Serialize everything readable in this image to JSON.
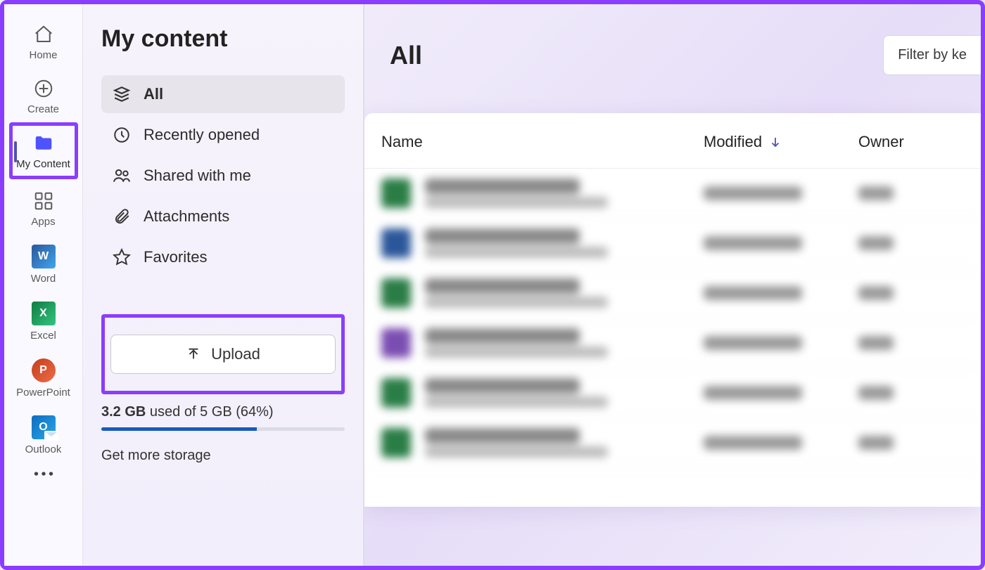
{
  "rail": {
    "items": [
      {
        "id": "home",
        "label": "Home"
      },
      {
        "id": "create",
        "label": "Create"
      },
      {
        "id": "mycontent",
        "label": "My Content",
        "selected": true,
        "highlighted": true
      },
      {
        "id": "apps",
        "label": "Apps"
      },
      {
        "id": "word",
        "label": "Word"
      },
      {
        "id": "excel",
        "label": "Excel"
      },
      {
        "id": "powerpoint",
        "label": "PowerPoint"
      },
      {
        "id": "outlook",
        "label": "Outlook"
      }
    ]
  },
  "sidebar": {
    "title": "My content",
    "nav": [
      {
        "label": "All",
        "active": true
      },
      {
        "label": "Recently opened"
      },
      {
        "label": "Shared with me"
      },
      {
        "label": "Attachments"
      },
      {
        "label": "Favorites"
      }
    ],
    "upload_label": "Upload",
    "storage": {
      "used": "3.2 GB",
      "middle": " used of 5 GB (64%)",
      "percent": 64
    },
    "get_more": "Get more storage"
  },
  "main": {
    "title": "All",
    "filter_label": "Filter by ke",
    "columns": {
      "name": "Name",
      "modified": "Modified",
      "owner": "Owner"
    },
    "rows_color": [
      "green",
      "blue",
      "green",
      "purple",
      "green",
      "green"
    ]
  },
  "colors": {
    "accent": "#8b3dff",
    "primary": "#4f52b2"
  }
}
